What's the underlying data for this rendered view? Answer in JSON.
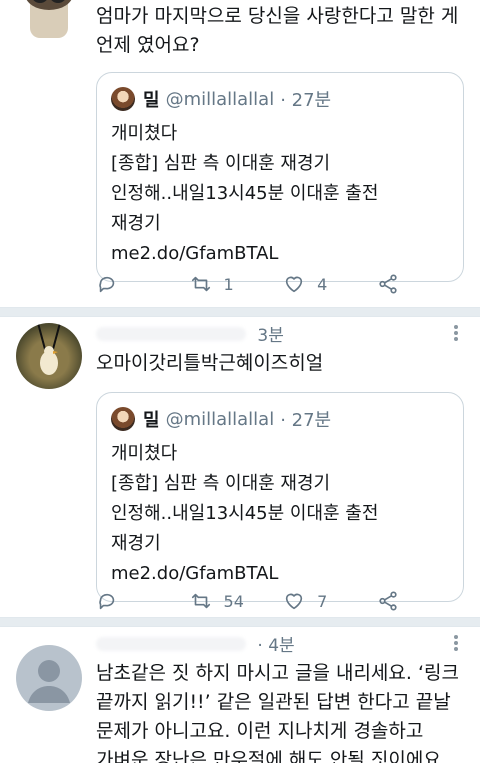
{
  "tweets": [
    {
      "text": "엄마가 마지막으로 당신을 사랑한다고 말한 게 언제 였어요?",
      "quote": {
        "name": "밀",
        "handle": "@millallallal",
        "time": "· 27분",
        "lines": [
          "개미쳤다",
          "[종합] 심판 측 이대훈 재경기",
          "인정해..내일13시45분 이대훈 출전",
          "재경기",
          "me2.do/GfamBTAL"
        ]
      },
      "actions": {
        "retweets": "1",
        "likes": "4"
      }
    },
    {
      "time": "3분",
      "text": "오마이갓리틀박근혜이즈히얼",
      "quote": {
        "name": "밀",
        "handle": "@millallallal",
        "time": "· 27분",
        "lines": [
          "개미쳤다",
          "[종합] 심판 측 이대훈 재경기",
          "인정해..내일13시45분 이대훈 출전",
          "재경기",
          "me2.do/GfamBTAL"
        ]
      },
      "actions": {
        "retweets": "54",
        "likes": "7"
      }
    },
    {
      "time": "· 4분",
      "text": "남초같은 짓 하지 마시고 글을 내리세요. ‘링크 끝까지 읽기!!’ 같은 일관된 답변 한다고 끝날 문제가 아니고요. 이런 지나치게 경솔하고 가벼운 장난은 만우절에 해도 안될 짓이에요."
    }
  ],
  "icons": {
    "reply": "reply-icon",
    "retweet": "retweet-icon",
    "like": "heart-icon",
    "share": "share-icon",
    "more": "more-dots-icon"
  },
  "colors": {
    "text": "#14171a",
    "muted": "#657786",
    "border": "#ccd6dd",
    "divider": "#e6ecf0"
  }
}
